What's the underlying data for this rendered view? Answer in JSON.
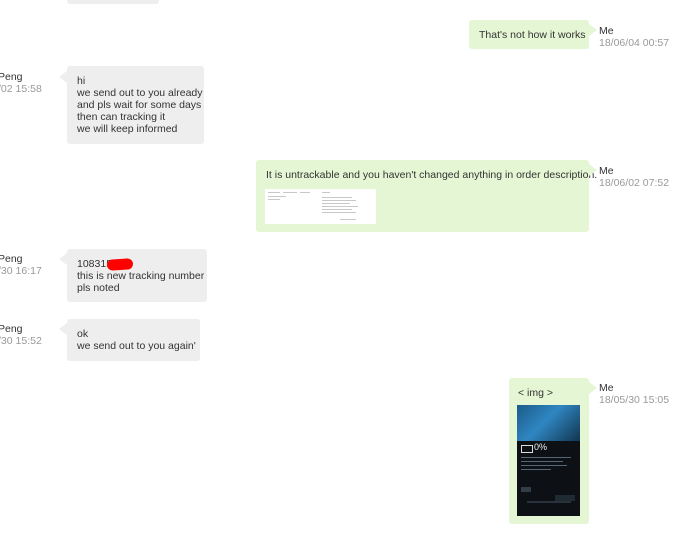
{
  "messages": [
    {
      "id": "m1",
      "side": "out",
      "sender": "Me",
      "time": "18/06/04 00:57",
      "lines": [
        "That's not how it works"
      ]
    },
    {
      "id": "m2",
      "side": "in",
      "sender": "Peng",
      "time": "/02 15:58",
      "lines": [
        "hi",
        "we send out to you already",
        "and pls wait for some days",
        "then can tracking it",
        "we will keep informed"
      ]
    },
    {
      "id": "m3",
      "side": "out",
      "sender": "Me",
      "time": "18/06/02 07:52",
      "lines": [
        "It is untrackable and you haven't changed anything in order description."
      ]
    },
    {
      "id": "m4",
      "side": "in",
      "sender": "Peng",
      "time": "/30 16:17",
      "lines": [
        "108315",
        "this is new tracking number",
        "pls noted"
      ]
    },
    {
      "id": "m5",
      "side": "in",
      "sender": "Peng",
      "time": "/30 15:52",
      "lines": [
        "ok",
        "we send out to you again'"
      ]
    },
    {
      "id": "m6",
      "side": "out",
      "sender": "Me",
      "time": "18/05/30 15:05",
      "lines": [
        "< img >"
      ]
    }
  ],
  "phone_screenshot": {
    "battery_text": "0%"
  },
  "colors": {
    "incoming": "#eeeeee",
    "outgoing": "#e5f6d4",
    "time": "#999999",
    "redaction": "#ff0000"
  }
}
